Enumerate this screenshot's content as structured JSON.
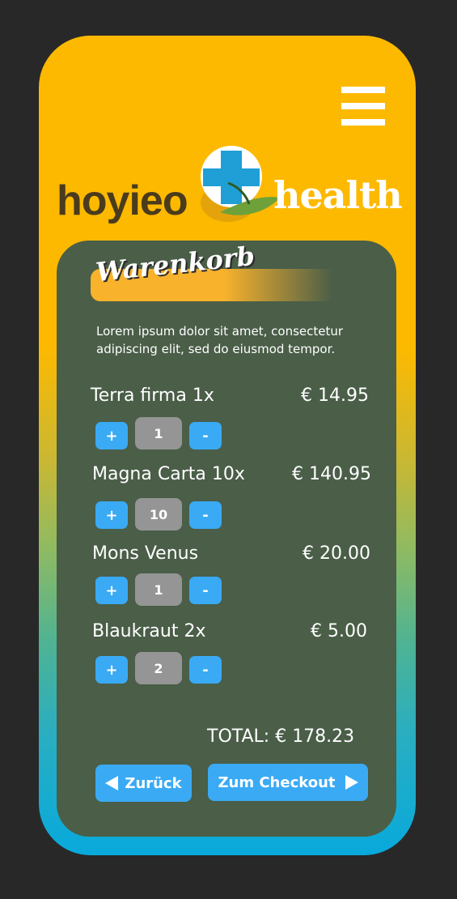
{
  "brand": {
    "left": "hoyieo",
    "right": "health",
    "colors": {
      "yellow": "#fdb900",
      "blue": "#08a9dc",
      "panel": "#4a5e48",
      "button": "#3aaaf4"
    }
  },
  "header": {
    "menu_icon": "hamburger-menu-icon"
  },
  "cart": {
    "title": "Warenkorb",
    "intro": "Lorem ipsum dolor sit amet, consectetur adipiscing elit, sed do eiusmod tempor.",
    "items": [
      {
        "name": "Terra firma  1x",
        "price": "€ 14.95",
        "qty": "1",
        "plus": "+",
        "minus": "-"
      },
      {
        "name": "Magna Carta 10x",
        "price": "€ 140.95",
        "qty": "10",
        "plus": "+",
        "minus": "-"
      },
      {
        "name": "Mons Venus",
        "price": "€ 20.00",
        "qty": "1",
        "plus": "+",
        "minus": "-"
      },
      {
        "name": "Blaukraut 2x",
        "price": "€ 5.00",
        "qty": "2",
        "plus": "+",
        "minus": "-"
      }
    ],
    "total": "TOTAL:  € 178.23"
  },
  "actions": {
    "back_label": "Zurück",
    "checkout_label": "Zum Checkout"
  }
}
